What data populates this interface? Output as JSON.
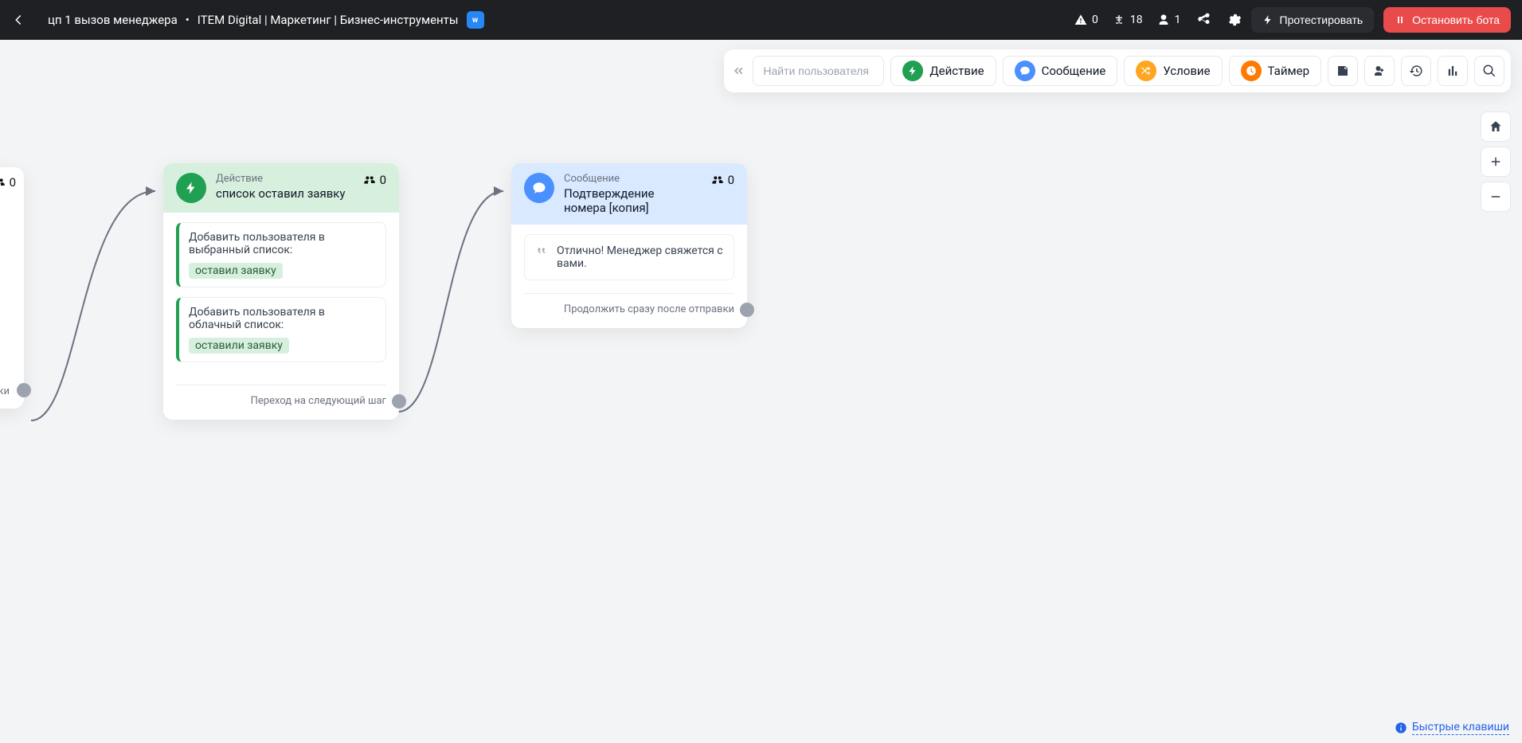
{
  "header": {
    "title_main": "цп 1 вызов менеджера",
    "title_sep": "•",
    "title_org": "ITEM Digital  |  Маркетинг  |  Бизнес-инструменты",
    "vk_label": "w",
    "stat_warn": "0",
    "stat_flow": "18",
    "stat_users": "1",
    "btn_test": "Протестировать",
    "btn_stop": "Остановить бота"
  },
  "toolbar": {
    "search_placeholder": "Найти пользователя",
    "chip_action": "Действие",
    "chip_message": "Сообщение",
    "chip_condition": "Условие",
    "chip_timer": "Таймер"
  },
  "partial_node": {
    "count": "0",
    "footer_tail": "ки"
  },
  "node_action": {
    "type": "Действие",
    "title": "список оставил заявку",
    "count": "0",
    "task1_text": "Добавить пользователя в выбранный список:",
    "task1_tag": "оставил заявку",
    "task2_text": "Добавить пользователя в облачный список:",
    "task2_tag": "оставили заявку",
    "footer": "Переход на следующий шаг"
  },
  "node_message": {
    "type": "Сообщение",
    "title": "Подтверждение номера [копия]",
    "count": "0",
    "body": "Отлично! Менеджер свяжется с вами.",
    "footer": "Продолжить сразу после отправки"
  },
  "hotkeys_label": "Быстрые клавиши"
}
